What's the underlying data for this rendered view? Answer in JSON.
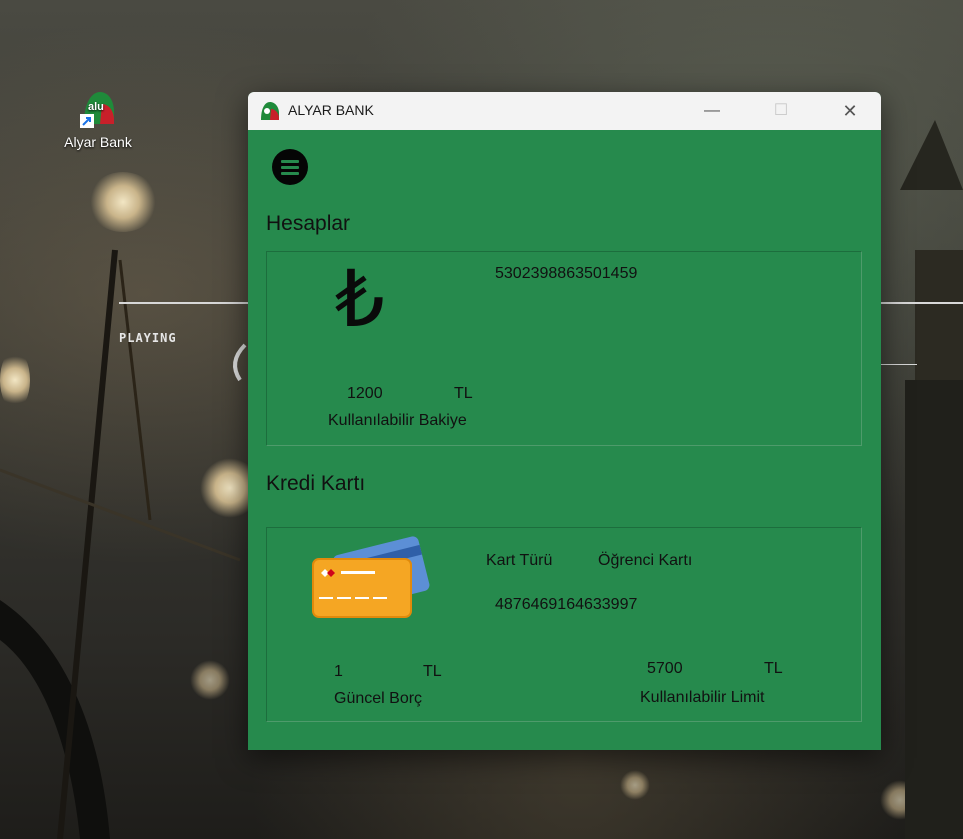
{
  "desktop": {
    "icon_label": "Alyar Bank",
    "icon_badge": "alu",
    "playing_text": "PLAYING"
  },
  "window": {
    "title": "ALYAR BANK",
    "controls": {
      "minimize": "—",
      "maximize": "☐",
      "close": "✕"
    }
  },
  "accounts": {
    "section_title": "Hesaplar",
    "currency_symbol": "₺",
    "account_number": "5302398863501459",
    "balance_value": "1200",
    "balance_currency": "TL",
    "balance_label": "Kullanılabilir Bakiye"
  },
  "credit_card": {
    "section_title": "Kredi Kartı",
    "card_type_label": "Kart Türü",
    "card_type_value": "Öğrenci Kartı",
    "card_number": "4876469164633997",
    "debt_value": "1",
    "debt_currency": "TL",
    "debt_label": "Güncel Borç",
    "limit_value": "5700",
    "limit_currency": "TL",
    "limit_label": "Kullanılabilir Limit"
  },
  "colors": {
    "window_green": "#268a4d",
    "titlebar": "#f3f3f3",
    "text": "#111111"
  }
}
